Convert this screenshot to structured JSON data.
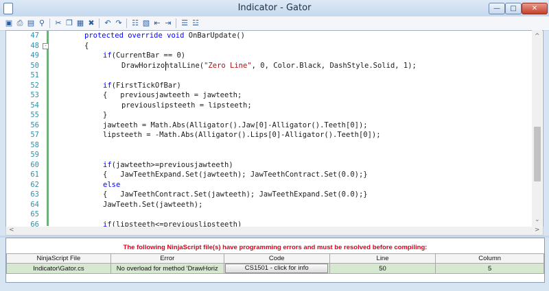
{
  "window": {
    "title": "Indicator - Gator"
  },
  "toolbar": {
    "icons": [
      "save-icon",
      "print-icon",
      "print-preview-icon",
      "find-icon",
      "cut-icon",
      "copy-icon",
      "paste-icon",
      "delete-icon",
      "undo-icon",
      "redo-icon",
      "find-replace-icon",
      "bookmark-icon",
      "outdent-icon",
      "indent-icon",
      "comment-icon",
      "uncomment-icon"
    ]
  },
  "editor": {
    "lines": [
      {
        "n": "47",
        "code": "protected override void OnBarUpdate()",
        "indent": 0
      },
      {
        "n": "48",
        "code": "{",
        "indent": 0
      },
      {
        "n": "49",
        "code": "if(CurrentBar == 0)",
        "indent": 1
      },
      {
        "n": "50",
        "code": "DrawHorizontalLine(\"Zero Line\", 0, Color.Black, DashStyle.Solid, 1);",
        "indent": 2
      },
      {
        "n": "51",
        "code": "",
        "indent": 0
      },
      {
        "n": "52",
        "code": "if(FirstTickOfBar)",
        "indent": 1
      },
      {
        "n": "53",
        "code": "{   previousjawteeth = jawteeth;",
        "indent": 1
      },
      {
        "n": "54",
        "code": "previouslipsteeth = lipsteeth;",
        "indent": 2
      },
      {
        "n": "55",
        "code": "}",
        "indent": 1
      },
      {
        "n": "56",
        "code": "jawteeth = Math.Abs(Alligator().Jaw[0]-Alligator().Teeth[0]);",
        "indent": 1
      },
      {
        "n": "57",
        "code": "lipsteeth = -Math.Abs(Alligator().Lips[0]-Alligator().Teeth[0]);",
        "indent": 1
      },
      {
        "n": "58",
        "code": "",
        "indent": 0
      },
      {
        "n": "59",
        "code": "",
        "indent": 0
      },
      {
        "n": "60",
        "code": "if(jawteeth>=previousjawteeth)",
        "indent": 1
      },
      {
        "n": "61",
        "code": "{   JawTeethExpand.Set(jawteeth); JawTeethContract.Set(0.0);}",
        "indent": 1
      },
      {
        "n": "62",
        "code": "else",
        "indent": 1
      },
      {
        "n": "63",
        "code": "{   JawTeethContract.Set(jawteeth); JawTeethExpand.Set(0.0);}",
        "indent": 1
      },
      {
        "n": "64",
        "code": "JawTeeth.Set(jawteeth);",
        "indent": 1
      },
      {
        "n": "65",
        "code": "",
        "indent": 0
      },
      {
        "n": "66",
        "code": "if(lipsteeth<=previouslipsteeth)",
        "indent": 1
      }
    ]
  },
  "errors": {
    "message": "The following NinjaScript file(s) have programming errors and must be resolved before compiling:",
    "headers": [
      "NinjaScript File",
      "Error",
      "Code",
      "Line",
      "Column"
    ],
    "rows": [
      {
        "file": "Indicator\\Gator.cs",
        "error": "No overload for method 'DrawHoriz",
        "code": "CS1501 - click for info",
        "line": "50",
        "column": "5"
      }
    ]
  }
}
